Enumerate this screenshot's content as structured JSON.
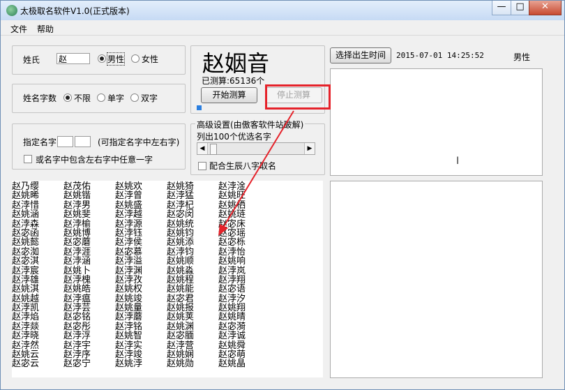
{
  "window": {
    "title": "太极取名软件V1.0(正式版本)",
    "min_glyph": "—",
    "max_glyph": "□",
    "close_glyph": "✕"
  },
  "menu": {
    "file": "文件",
    "help": "帮助"
  },
  "surname": {
    "label": "姓氏",
    "value": "赵",
    "male": "男性",
    "female": "女性"
  },
  "name_length": {
    "label": "姓名字数",
    "unlimited": "不限",
    "single": "单字",
    "double": "双字"
  },
  "specify": {
    "label": "指定名字",
    "hint": "(可指定名字中左右字)",
    "option": "或名字中包含左右字中任意一字"
  },
  "result": {
    "name": "赵姻音",
    "count": "已测算:65136个",
    "start": "开始测算",
    "stop": "停止测算",
    "progress": 0.04
  },
  "advanced": {
    "title": "高级设置(由傲客软件站破解)",
    "list_label": "列出100个优选名字",
    "bazi": "配合生辰八字取名",
    "slider": 0.03
  },
  "birth": {
    "button": "选择出生时间",
    "datetime": "2015-07-01 14:25:52",
    "gender": "男性"
  },
  "names": [
    [
      "赵乃缨",
      "赵姚晞",
      "赵浡惜",
      "赵姚涵",
      "赵浡森",
      "赵宓函",
      "赵姚懿",
      "赵宓洳",
      "赵宓淇",
      "赵浡宸",
      "赵浡雄",
      "赵姚淇",
      "赵姚越",
      "赵浡凯",
      "赵浡焰",
      "赵浡燚",
      "赵浡晓",
      "赵浡然",
      "赵姚云",
      "赵宓云"
    ],
    [
      "赵茂佑",
      "赵姚锴",
      "赵浡男",
      "赵姚斐",
      "赵浡榆",
      "赵姚博",
      "赵宓蘑",
      "赵浡涯",
      "赵浡涵",
      "赵姚卜",
      "赵浡槐",
      "赵姚皓",
      "赵浡瘟",
      "赵浡芸",
      "赵宓铭",
      "赵宓彤",
      "赵浡浮",
      "赵浡宇",
      "赵浡序",
      "赵宓宁"
    ],
    [
      "赵姚欢",
      "赵浡曾",
      "赵姚盛",
      "赵浡越",
      "赵浡源",
      "赵浡钰",
      "赵浡侯",
      "赵宓慕",
      "赵浡溢",
      "赵浡渊",
      "赵浡孜",
      "赵姚权",
      "赵姚竣",
      "赵姚量",
      "赵浡蘑",
      "赵浡铭",
      "赵姚智",
      "赵浡实",
      "赵浡竣",
      "赵姚浡"
    ],
    [
      "赵姚猗",
      "赵浡猛",
      "赵浡杞",
      "赵宓闵",
      "赵姚统",
      "赵姚钧",
      "赵姚添",
      "赵浡钧",
      "赵姚顺",
      "赵姚淼",
      "赵姚程",
      "赵姚能",
      "赵宓君",
      "赵姚报",
      "赵姚荚",
      "赵姚渊",
      "赵宓腼",
      "赵浡营",
      "赵姚娴",
      "赵姚勋"
    ],
    [
      "赵浡淦",
      "赵姚旺",
      "赵姚栖",
      "赵姚琏",
      "赵宓床",
      "赵宓瑶",
      "赵宓栎",
      "赵浡怡",
      "赵姚响",
      "赵浡岚",
      "赵浡翔",
      "赵宓语",
      "赵浡汐",
      "赵姚翔",
      "赵姚晴",
      "赵宓漪",
      "赵浡诚",
      "赵姚舜",
      "赵宓萌",
      "赵姚晶"
    ]
  ]
}
